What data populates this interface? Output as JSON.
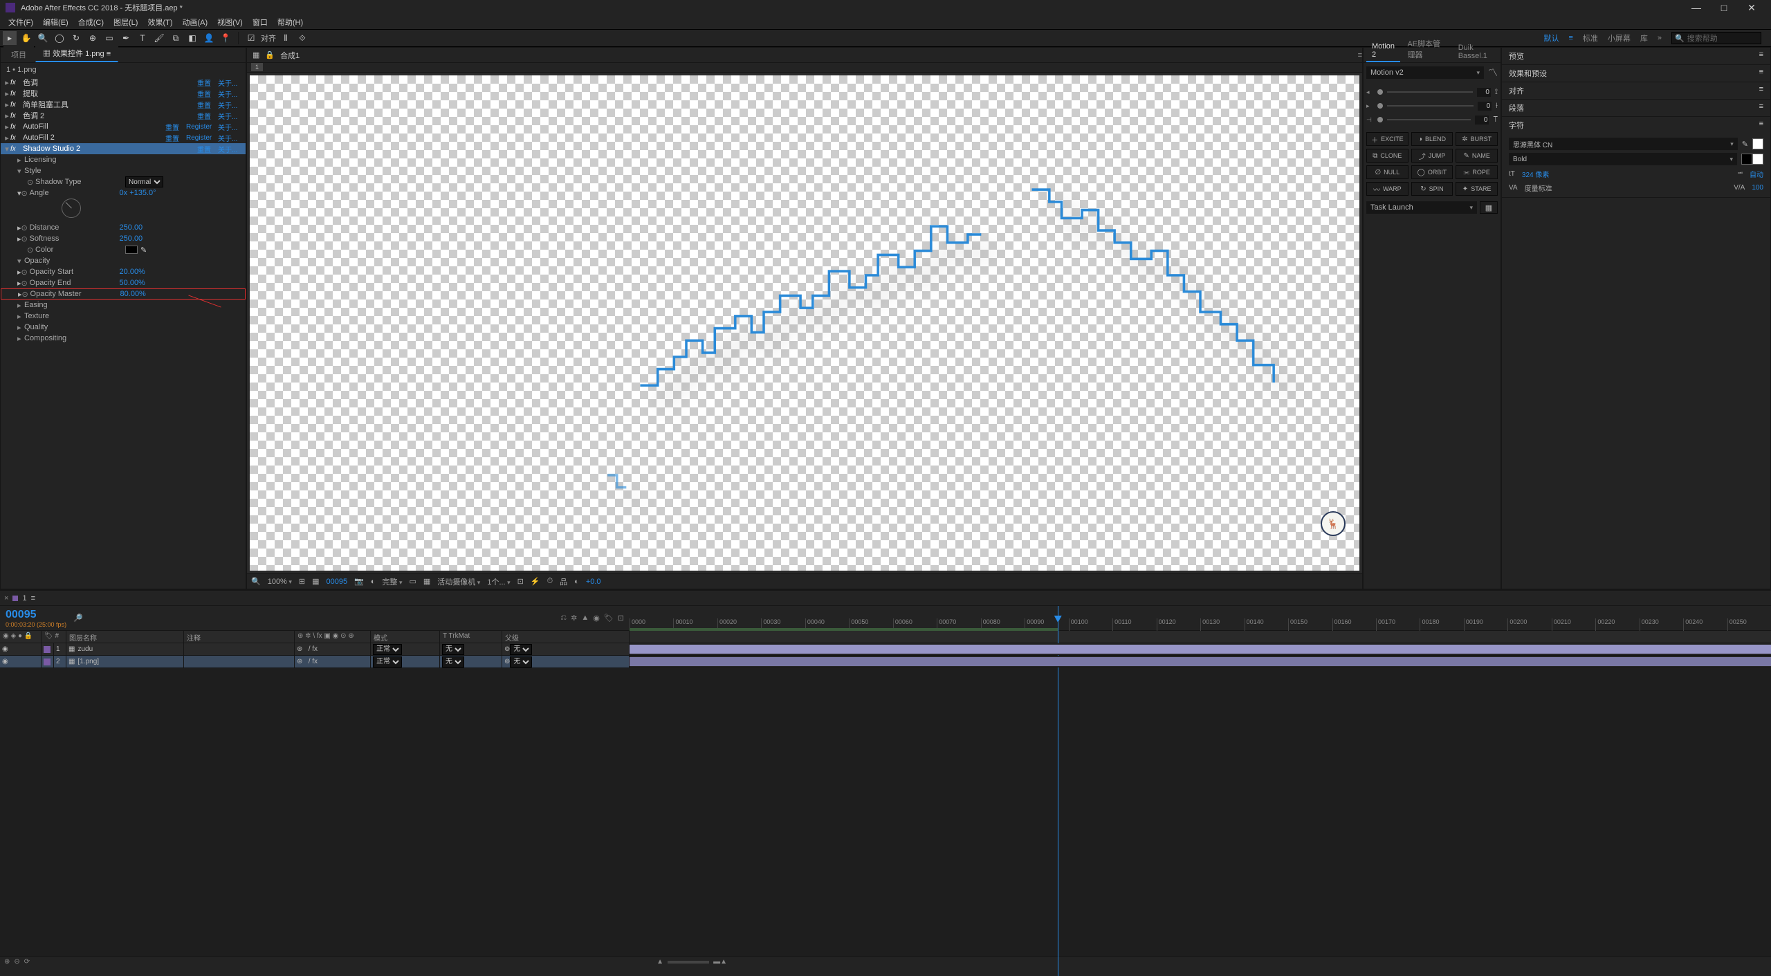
{
  "title": "Adobe After Effects CC 2018 - 无标题项目.aep *",
  "menu": [
    "文件(F)",
    "编辑(E)",
    "合成(C)",
    "图层(L)",
    "效果(T)",
    "动画(A)",
    "视图(V)",
    "窗口",
    "帮助(H)"
  ],
  "toolbar": {
    "align_label": "对齐",
    "search_placeholder": "搜索帮助"
  },
  "workspaces": [
    "默认",
    "标准",
    "小屏幕",
    "库"
  ],
  "ec": {
    "tabs": {
      "project": "项目",
      "controls": "效果控件 1.png"
    },
    "layer": "1 • 1.png",
    "effects": [
      {
        "name": "色调",
        "reset": "重置",
        "about": "关于..."
      },
      {
        "name": "提取",
        "reset": "重置",
        "about": "关于..."
      },
      {
        "name": "简单阻塞工具",
        "reset": "重置",
        "about": "关于..."
      },
      {
        "name": "色调 2",
        "reset": "重置",
        "about": "关于..."
      },
      {
        "name": "AutoFill",
        "reset": "重置",
        "reg": "Register",
        "about": "关于..."
      },
      {
        "name": "AutoFill 2",
        "reset": "重置",
        "reg": "Register",
        "about": "关于..."
      },
      {
        "name": "Shadow Studio 2",
        "reset": "重置",
        "about": "关于...",
        "selected": true
      }
    ],
    "shadow": {
      "licensing": "Licensing",
      "style": "Style",
      "shadow_type_label": "Shadow Type",
      "shadow_type": "Normal",
      "angle_label": "Angle",
      "angle": "0x +135.0°",
      "distance_label": "Distance",
      "distance": "250.00",
      "softness_label": "Softness",
      "softness": "250.00",
      "color_label": "Color",
      "opacity": "Opacity",
      "op_start_label": "Opacity Start",
      "op_start": "20.00%",
      "op_end_label": "Opacity End",
      "op_end": "50.00%",
      "op_master_label": "Opacity Master",
      "op_master": "80.00%",
      "easing": "Easing",
      "texture": "Texture",
      "quality": "Quality",
      "compositing": "Compositing"
    }
  },
  "comp": {
    "name": "合成1",
    "marker": "1"
  },
  "viewfooter": {
    "zoom": "100%",
    "frame": "00095",
    "res": "完整",
    "camera": "活动摄像机",
    "views": "1个...",
    "exposure": "+0.0"
  },
  "motion": {
    "tabs": [
      "Motion 2",
      "AE脚本管理器",
      "Duik Bassel.1"
    ],
    "preset": "Motion v2",
    "sliders": [
      0,
      0,
      0
    ],
    "buttons": [
      {
        "ic": "＋",
        "t": "EXCITE"
      },
      {
        "ic": "◑",
        "t": "BLEND"
      },
      {
        "ic": "✲",
        "t": "BURST"
      },
      {
        "ic": "⧉",
        "t": "CLONE"
      },
      {
        "ic": "⤴",
        "t": "JUMP"
      },
      {
        "ic": "✎",
        "t": "NAME"
      },
      {
        "ic": "∅",
        "t": "NULL"
      },
      {
        "ic": "◯",
        "t": "ORBIT"
      },
      {
        "ic": "⫘",
        "t": "ROPE"
      },
      {
        "ic": "〰",
        "t": "WARP"
      },
      {
        "ic": "↻",
        "t": "SPIN"
      },
      {
        "ic": "✦",
        "t": "STARE"
      }
    ],
    "task": "Task Launch"
  },
  "info_panels": [
    "预览",
    "效果和预设",
    "对齐",
    "段落",
    "字符"
  ],
  "char": {
    "font": "思源黑体 CN",
    "weight": "Bold",
    "size": "324 像素",
    "auto": "自动",
    "track": "度量标准",
    "va": "100"
  },
  "timeline": {
    "tab": "1",
    "time": "00095",
    "time_sub": "0:00:03:20 (25:00 fps)",
    "cols": {
      "layer_name": "图层名称",
      "comment": "注释",
      "mode": "模式",
      "trkmat": "T  TrkMat",
      "parent": "父级"
    },
    "layers": [
      {
        "num": "1",
        "name": "zudu",
        "mode": "正常",
        "trk": "无",
        "parent": "无"
      },
      {
        "num": "2",
        "name": "[1.png]",
        "mode": "正常",
        "trk": "无",
        "parent": "无",
        "sel": true
      }
    ],
    "ticks": [
      "0000",
      "00010",
      "00020",
      "00030",
      "00040",
      "00050",
      "00060",
      "00070",
      "00080",
      "00090",
      "00100",
      "00110",
      "00120",
      "00130",
      "00140",
      "00150",
      "00160",
      "00170",
      "00180",
      "00190",
      "00200",
      "00210",
      "00220",
      "00230",
      "00240",
      "00250"
    ]
  }
}
